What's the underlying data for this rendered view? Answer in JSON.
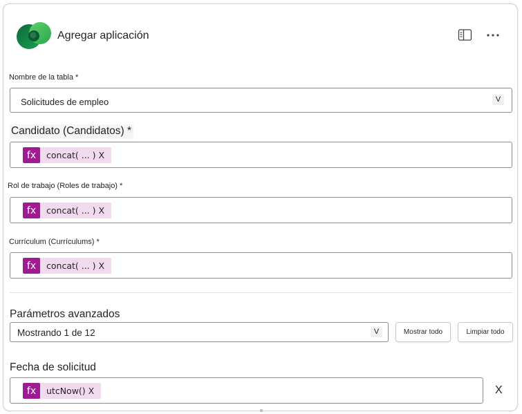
{
  "header": {
    "title": "Agregar aplicación"
  },
  "table": {
    "label": "Nombre de la tabla *",
    "value": "Solicitudes de empleo",
    "chevron": "V"
  },
  "fields": {
    "candidato": {
      "label": "Candidato (Candidatos) *",
      "token": "concat( ... ) X",
      "fx": "fx"
    },
    "rol": {
      "label": "Rol de trabajo (Roles de trabajo) *",
      "token": "concat( ... ) X",
      "fx": "fx"
    },
    "curriculum": {
      "label": "Currículum (Currículums) *",
      "token": "concat( ... ) X",
      "fx": "fx"
    }
  },
  "advanced": {
    "label": "Parámetros avanzados",
    "showing": "Mostrando 1 de 12",
    "chevron": "V",
    "show_all": "Mostrar todo",
    "clear_all": "Limpiar todo"
  },
  "fecha": {
    "label": "Fecha de solicitud",
    "token": "utcNow() X",
    "fx": "fx",
    "remove": "X"
  },
  "icons": {
    "app": "dataverse-logo",
    "panel": "side-panel-icon",
    "more": "more-icon"
  }
}
